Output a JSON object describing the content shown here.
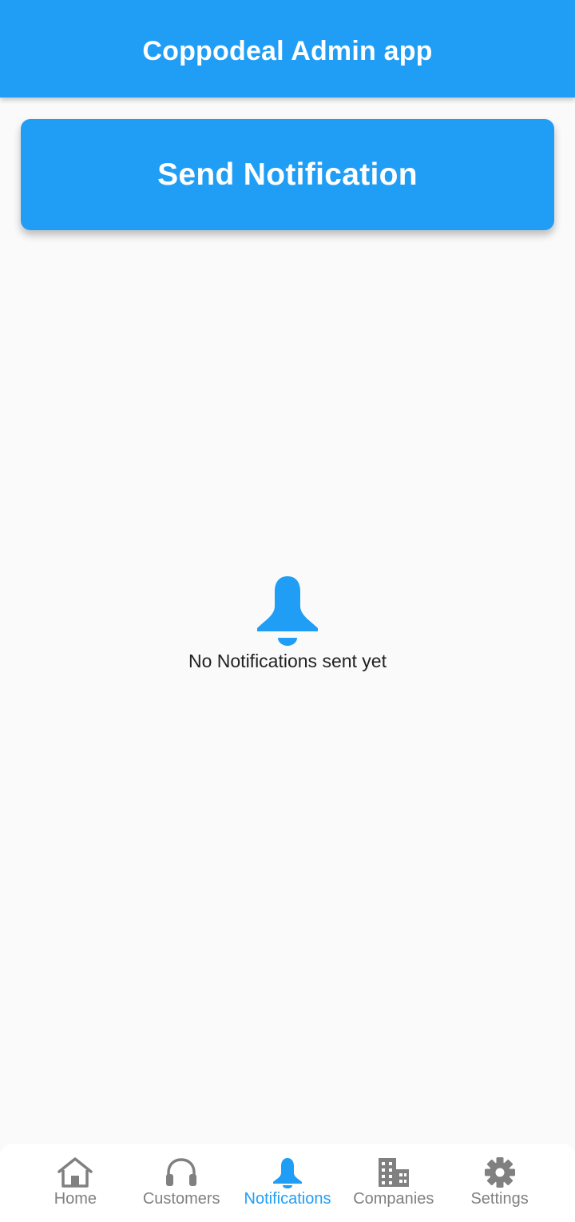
{
  "app_bar": {
    "title": "Coppodeal Admin app"
  },
  "actions": {
    "send_notification_label": "Send Notification"
  },
  "empty_state": {
    "icon": "bell-icon",
    "message": "No Notifications sent yet"
  },
  "bottom_nav": {
    "active_tab": "Notifications",
    "items": [
      {
        "label": "Home",
        "icon": "home-icon"
      },
      {
        "label": "Customers",
        "icon": "headset-icon"
      },
      {
        "label": "Notifications",
        "icon": "bell-icon"
      },
      {
        "label": "Companies",
        "icon": "building-icon"
      },
      {
        "label": "Settings",
        "icon": "gear-icon"
      }
    ]
  },
  "colors": {
    "primary": "#209ef6",
    "background": "#fafafa",
    "inactive": "#808080",
    "text": "#222222"
  }
}
